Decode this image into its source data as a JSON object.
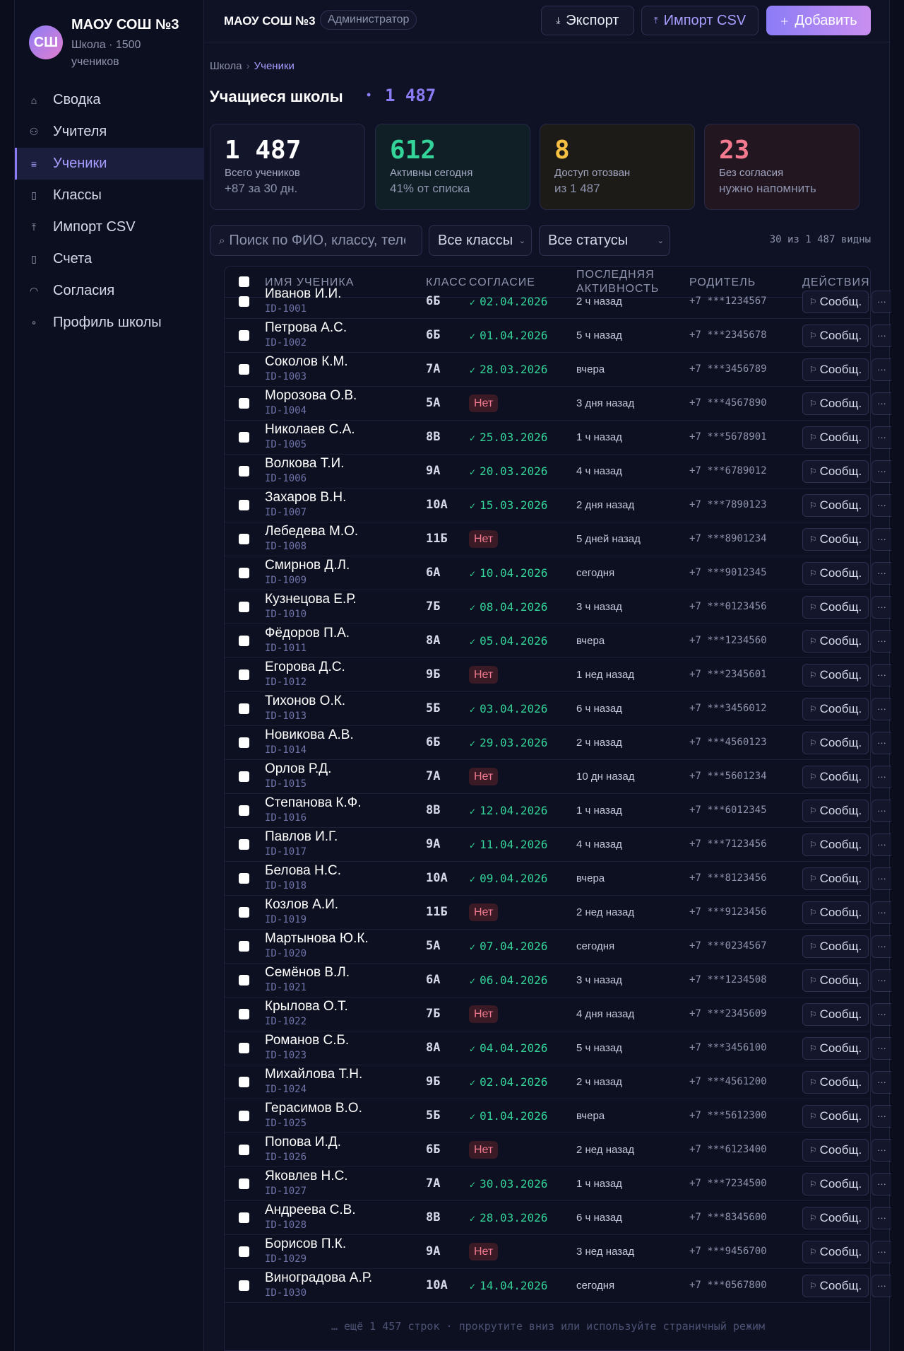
{
  "sidebar": {
    "logo": "СШ",
    "title": "МАОУ СОШ №3",
    "subtitle": "Школа · 1500 учеников",
    "items": [
      {
        "label": "Сводка",
        "icon": "home-icon",
        "glyph": "⌂",
        "active": false
      },
      {
        "label": "Учителя",
        "icon": "user-icon",
        "glyph": "⚇",
        "active": false
      },
      {
        "label": "Ученики",
        "icon": "list-icon",
        "glyph": "≡",
        "active": true
      },
      {
        "label": "Классы",
        "icon": "book-icon",
        "glyph": "▯",
        "active": false
      },
      {
        "label": "Импорт CSV",
        "icon": "upload-icon",
        "glyph": "⤒",
        "active": false
      },
      {
        "label": "Счета",
        "icon": "file-icon",
        "glyph": "▯",
        "active": false
      },
      {
        "label": "Согласия",
        "icon": "shield-icon",
        "glyph": "◠",
        "active": false
      },
      {
        "label": "Профиль школы",
        "icon": "dot-icon",
        "glyph": "∘",
        "active": false
      }
    ]
  },
  "header": {
    "title": "МАОУ СОШ №3",
    "role": "Администратор",
    "export_label": "Экспорт",
    "import_label": "Импорт CSV",
    "add_label": "Добавить"
  },
  "breadcrumb": {
    "root": "Школа",
    "current": "Ученики"
  },
  "page": {
    "title": "Учащиеся школы",
    "count": "1 487"
  },
  "stats": [
    {
      "value": "1 487",
      "label": "Всего учеников",
      "sub": "+87 за 30 дн."
    },
    {
      "value": "612",
      "label": "Активны сегодня",
      "sub": "41% от списка"
    },
    {
      "value": "8",
      "label": "Доступ отозван",
      "sub": "из 1 487"
    },
    {
      "value": "23",
      "label": "Без согласия",
      "sub": "нужно напомнить"
    }
  ],
  "filters": {
    "search_placeholder": "Поиск по ФИО, классу, телефону",
    "class_select": "Все классы",
    "status_select": "Все статусы",
    "visible_text": "30 из 1 487 видны"
  },
  "table": {
    "headers": {
      "name": "ИМЯ УЧЕНИКА",
      "class": "КЛАСС",
      "consent": "СОГЛАСИЕ",
      "activity": "ПОСЛЕДНЯЯ АКТИВНОСТЬ",
      "parent": "РОДИТЕЛЬ",
      "actions": "ДЕЙСТВИЯ"
    },
    "message_label": "Сообщ.",
    "no_label": "Нет",
    "more_label": "···",
    "more_note": "… ещё 1 457 строк · прокрутите вниз или используйте страничный режим",
    "rows": [
      {
        "name": "Иванов И.И.",
        "id": "ID-1001",
        "class": "6Б",
        "consent": "02.04.2026",
        "activity": "2 ч назад",
        "phone": "+7 ***1234567"
      },
      {
        "name": "Петрова А.С.",
        "id": "ID-1002",
        "class": "6Б",
        "consent": "01.04.2026",
        "activity": "5 ч назад",
        "phone": "+7 ***2345678"
      },
      {
        "name": "Соколов К.М.",
        "id": "ID-1003",
        "class": "7А",
        "consent": "28.03.2026",
        "activity": "вчера",
        "phone": "+7 ***3456789"
      },
      {
        "name": "Морозова О.В.",
        "id": "ID-1004",
        "class": "5А",
        "consent": null,
        "activity": "3 дня назад",
        "phone": "+7 ***4567890"
      },
      {
        "name": "Николаев С.А.",
        "id": "ID-1005",
        "class": "8В",
        "consent": "25.03.2026",
        "activity": "1 ч назад",
        "phone": "+7 ***5678901"
      },
      {
        "name": "Волкова Т.И.",
        "id": "ID-1006",
        "class": "9А",
        "consent": "20.03.2026",
        "activity": "4 ч назад",
        "phone": "+7 ***6789012"
      },
      {
        "name": "Захаров В.Н.",
        "id": "ID-1007",
        "class": "10А",
        "consent": "15.03.2026",
        "activity": "2 дня назад",
        "phone": "+7 ***7890123"
      },
      {
        "name": "Лебедева М.О.",
        "id": "ID-1008",
        "class": "11Б",
        "consent": null,
        "activity": "5 дней назад",
        "phone": "+7 ***8901234"
      },
      {
        "name": "Смирнов Д.Л.",
        "id": "ID-1009",
        "class": "6А",
        "consent": "10.04.2026",
        "activity": "сегодня",
        "phone": "+7 ***9012345"
      },
      {
        "name": "Кузнецова Е.Р.",
        "id": "ID-1010",
        "class": "7Б",
        "consent": "08.04.2026",
        "activity": "3 ч назад",
        "phone": "+7 ***0123456"
      },
      {
        "name": "Фёдоров П.А.",
        "id": "ID-1011",
        "class": "8А",
        "consent": "05.04.2026",
        "activity": "вчера",
        "phone": "+7 ***1234560"
      },
      {
        "name": "Егорова Д.С.",
        "id": "ID-1012",
        "class": "9Б",
        "consent": null,
        "activity": "1 нед назад",
        "phone": "+7 ***2345601"
      },
      {
        "name": "Тихонов О.К.",
        "id": "ID-1013",
        "class": "5Б",
        "consent": "03.04.2026",
        "activity": "6 ч назад",
        "phone": "+7 ***3456012"
      },
      {
        "name": "Новикова А.В.",
        "id": "ID-1014",
        "class": "6Б",
        "consent": "29.03.2026",
        "activity": "2 ч назад",
        "phone": "+7 ***4560123"
      },
      {
        "name": "Орлов Р.Д.",
        "id": "ID-1015",
        "class": "7А",
        "consent": null,
        "activity": "10 дн назад",
        "phone": "+7 ***5601234"
      },
      {
        "name": "Степанова К.Ф.",
        "id": "ID-1016",
        "class": "8В",
        "consent": "12.04.2026",
        "activity": "1 ч назад",
        "phone": "+7 ***6012345"
      },
      {
        "name": "Павлов И.Г.",
        "id": "ID-1017",
        "class": "9А",
        "consent": "11.04.2026",
        "activity": "4 ч назад",
        "phone": "+7 ***7123456"
      },
      {
        "name": "Белова Н.С.",
        "id": "ID-1018",
        "class": "10А",
        "consent": "09.04.2026",
        "activity": "вчера",
        "phone": "+7 ***8123456"
      },
      {
        "name": "Козлов А.И.",
        "id": "ID-1019",
        "class": "11Б",
        "consent": null,
        "activity": "2 нед назад",
        "phone": "+7 ***9123456"
      },
      {
        "name": "Мартынова Ю.К.",
        "id": "ID-1020",
        "class": "5А",
        "consent": "07.04.2026",
        "activity": "сегодня",
        "phone": "+7 ***0234567"
      },
      {
        "name": "Семёнов В.Л.",
        "id": "ID-1021",
        "class": "6А",
        "consent": "06.04.2026",
        "activity": "3 ч назад",
        "phone": "+7 ***1234508"
      },
      {
        "name": "Крылова О.Т.",
        "id": "ID-1022",
        "class": "7Б",
        "consent": null,
        "activity": "4 дня назад",
        "phone": "+7 ***2345609"
      },
      {
        "name": "Романов С.Б.",
        "id": "ID-1023",
        "class": "8А",
        "consent": "04.04.2026",
        "activity": "5 ч назад",
        "phone": "+7 ***3456100"
      },
      {
        "name": "Михайлова Т.Н.",
        "id": "ID-1024",
        "class": "9Б",
        "consent": "02.04.2026",
        "activity": "2 ч назад",
        "phone": "+7 ***4561200"
      },
      {
        "name": "Герасимов В.О.",
        "id": "ID-1025",
        "class": "5Б",
        "consent": "01.04.2026",
        "activity": "вчера",
        "phone": "+7 ***5612300"
      },
      {
        "name": "Попова И.Д.",
        "id": "ID-1026",
        "class": "6Б",
        "consent": null,
        "activity": "2 нед назад",
        "phone": "+7 ***6123400"
      },
      {
        "name": "Яковлев Н.С.",
        "id": "ID-1027",
        "class": "7А",
        "consent": "30.03.2026",
        "activity": "1 ч назад",
        "phone": "+7 ***7234500"
      },
      {
        "name": "Андреева С.В.",
        "id": "ID-1028",
        "class": "8В",
        "consent": "28.03.2026",
        "activity": "6 ч назад",
        "phone": "+7 ***8345600"
      },
      {
        "name": "Борисов П.К.",
        "id": "ID-1029",
        "class": "9А",
        "consent": null,
        "activity": "3 нед назад",
        "phone": "+7 ***9456700"
      },
      {
        "name": "Виноградова А.Р.",
        "id": "ID-1030",
        "class": "10А",
        "consent": "14.04.2026",
        "activity": "сегодня",
        "phone": "+7 ***0567800"
      }
    ]
  },
  "colors": {
    "accent": "#8b7cf6",
    "success": "#34d399",
    "warning": "#f6c143",
    "danger": "#f47a8f",
    "background": "#0f1224"
  }
}
